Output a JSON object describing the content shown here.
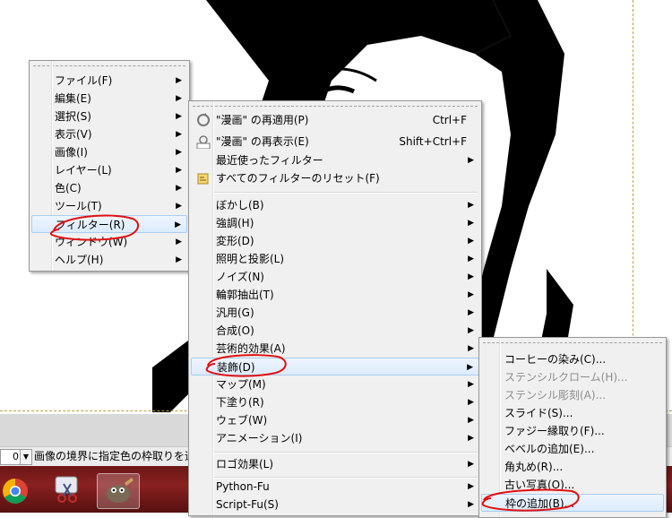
{
  "statusbar": {
    "zoom": "0 %",
    "message": "画像の境界に指定色の枠取りを追"
  },
  "main_menu": {
    "items": [
      {
        "label": "ファイル(F)"
      },
      {
        "label": "編集(E)"
      },
      {
        "label": "選択(S)"
      },
      {
        "label": "表示(V)"
      },
      {
        "label": "画像(I)"
      },
      {
        "label": "レイヤー(L)"
      },
      {
        "label": "色(C)"
      },
      {
        "label": "ツール(T)"
      },
      {
        "label": "フィルター(R)"
      },
      {
        "label": "ウィンドウ(W)"
      },
      {
        "label": "ヘルプ(H)"
      }
    ]
  },
  "filter_menu": {
    "top_items": [
      {
        "label": "\"漫画\" の再適用(P)",
        "shortcut": "Ctrl+F",
        "icon": "reapply-icon"
      },
      {
        "label": "\"漫画\" の再表示(E)",
        "shortcut": "Shift+Ctrl+F",
        "icon": "reshow-icon"
      },
      {
        "label": "最近使ったフィルター",
        "shortcut": ""
      },
      {
        "label": "すべてのフィルターのリセット(F)",
        "shortcut": "",
        "icon": "reset-icon"
      }
    ],
    "items": [
      {
        "label": "ぼかし(B)"
      },
      {
        "label": "強調(H)"
      },
      {
        "label": "変形(D)"
      },
      {
        "label": "照明と投影(L)"
      },
      {
        "label": "ノイズ(N)"
      },
      {
        "label": "輪郭抽出(T)"
      },
      {
        "label": "汎用(G)"
      },
      {
        "label": "合成(O)"
      },
      {
        "label": "芸術的効果(A)"
      },
      {
        "label": "装飾(D)"
      },
      {
        "label": "マップ(M)"
      },
      {
        "label": "下塗り(R)"
      },
      {
        "label": "ウェブ(W)"
      },
      {
        "label": "アニメーション(I)"
      }
    ],
    "logo_item": {
      "label": "ロゴ効果(L)"
    },
    "script_items": [
      {
        "label": "Python-Fu"
      },
      {
        "label": "Script-Fu(S)"
      }
    ]
  },
  "decor_menu": {
    "items": [
      {
        "label": "コーヒーの染み(C)...",
        "disabled": false
      },
      {
        "label": "ステンシルクローム(H)...",
        "disabled": true
      },
      {
        "label": "ステンシル彫刻(A)...",
        "disabled": true
      },
      {
        "label": "スライド(S)...",
        "disabled": false
      },
      {
        "label": "ファジー縁取り(F)...",
        "disabled": false
      },
      {
        "label": "ベベルの追加(E)...",
        "disabled": false
      },
      {
        "label": "角丸め(R)...",
        "disabled": false
      },
      {
        "label": "古い写真(O)...",
        "disabled": false
      },
      {
        "label": "枠の追加(B)...",
        "disabled": false
      }
    ]
  },
  "colors": {
    "highlight": "#dcebfc",
    "annotation": "#e01010",
    "taskbar": "#7a1a1a"
  }
}
